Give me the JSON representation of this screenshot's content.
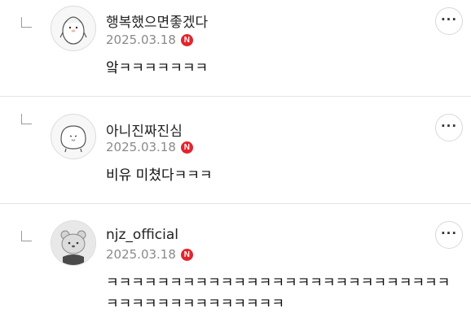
{
  "comments": [
    {
      "nickname": "행복했으면좋겠다",
      "date": "2025.03.18",
      "badge": "N",
      "text": "앜ㅋㅋㅋㅋㅋㅋㅋ",
      "more": "···",
      "avatar_icon": "penguin-icon"
    },
    {
      "nickname": "아니진짜진심",
      "date": "2025.03.18",
      "badge": "N",
      "text": "비유 미쳤다ㅋㅋㅋ",
      "more": "···",
      "avatar_icon": "blob-icon"
    },
    {
      "nickname": "njz_official",
      "date": "2025.03.18",
      "badge": "N",
      "text": "ㅋㅋㅋㅋㅋㅋㅋㅋㅋㅋㅋㅋㅋㅋㅋㅋㅋㅋㅋㅋㅋㅋㅋㅋㅋㅋㅋㅋㅋㅋㅋㅋㅋㅋㅋㅋㅋㅋㅋㅋㅋ",
      "more": "···",
      "avatar_icon": "bear-icon"
    }
  ],
  "colors": {
    "badge": "#e1252d",
    "date": "#8a8a8a",
    "divider": "#e4e4e4"
  }
}
